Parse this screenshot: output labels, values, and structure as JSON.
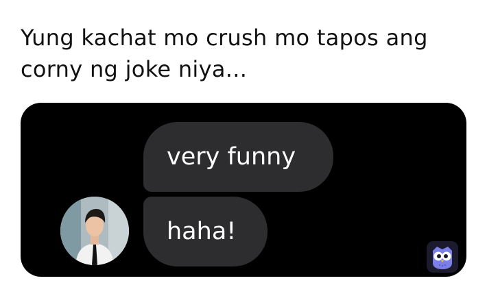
{
  "caption": {
    "text": "Yung kachat mo crush mo tapos ang corny ng joke niya..."
  },
  "chat": {
    "messages": [
      {
        "text": "very funny"
      },
      {
        "text": "haha!"
      }
    ],
    "colors": {
      "panel_bg": "#000000",
      "bubble_bg": "#2d2d2f",
      "bubble_text": "#ffffff"
    }
  },
  "icons": {
    "avatar": "avatar-photo",
    "app_logo": "owl-icon"
  }
}
